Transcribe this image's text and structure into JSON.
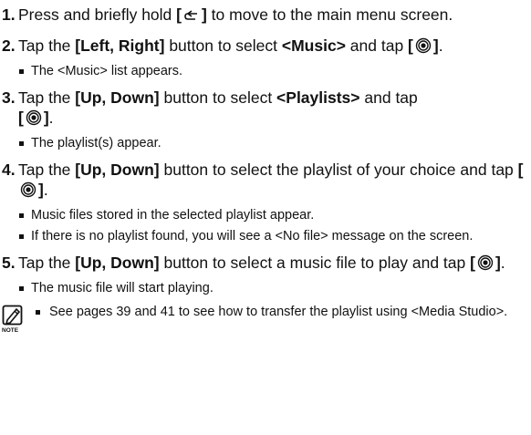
{
  "steps": [
    {
      "num": "1.",
      "t1": "Press and briefly hold ",
      "b1": "[",
      "icon": "back-icon",
      "b2": "]",
      "t2": " to move to the main menu screen."
    },
    {
      "num": "2.",
      "t1": "Tap the ",
      "b1": "[Left, Right]",
      "t2": " button to select ",
      "b2": "<Music>",
      "t3": " and tap ",
      "b3": "[",
      "icon": "select-icon",
      "b4": "]",
      "t4": ".",
      "bullets": [
        "The <Music> list appears."
      ]
    },
    {
      "num": "3.",
      "t1": "Tap the ",
      "b1": "[Up, Down]",
      "t2": " button to select ",
      "b2": "<Playlists>",
      "t3": " and tap ",
      "b3": "[",
      "icon": "select-icon",
      "b4": "]",
      "t4": ".",
      "bullets": [
        "The playlist(s) appear."
      ]
    },
    {
      "num": "4.",
      "t1": "Tap the ",
      "b1": "[Up, Down]",
      "t2": " button to select the playlist of your choice and tap ",
      "b3": "[",
      "icon": "select-icon",
      "b4": "]",
      "t4": ".",
      "bullets": [
        "Music files stored in the selected playlist appear.",
        "If there is no playlist found, you will see a <No file> message on the screen."
      ]
    },
    {
      "num": "5.",
      "t1": "Tap the ",
      "b1": "[Up, Down]",
      "t2": " button to select a music file to play and tap ",
      "b3": "[",
      "icon": "select-icon",
      "b4": "]",
      "t4": ".",
      "bullets": [
        "The music file will start playing."
      ]
    }
  ],
  "note": {
    "icon": "note-icon",
    "icon_label": "NOTE",
    "text": "See pages 39 and 41 to see how to transfer the playlist using <Media Studio>."
  }
}
